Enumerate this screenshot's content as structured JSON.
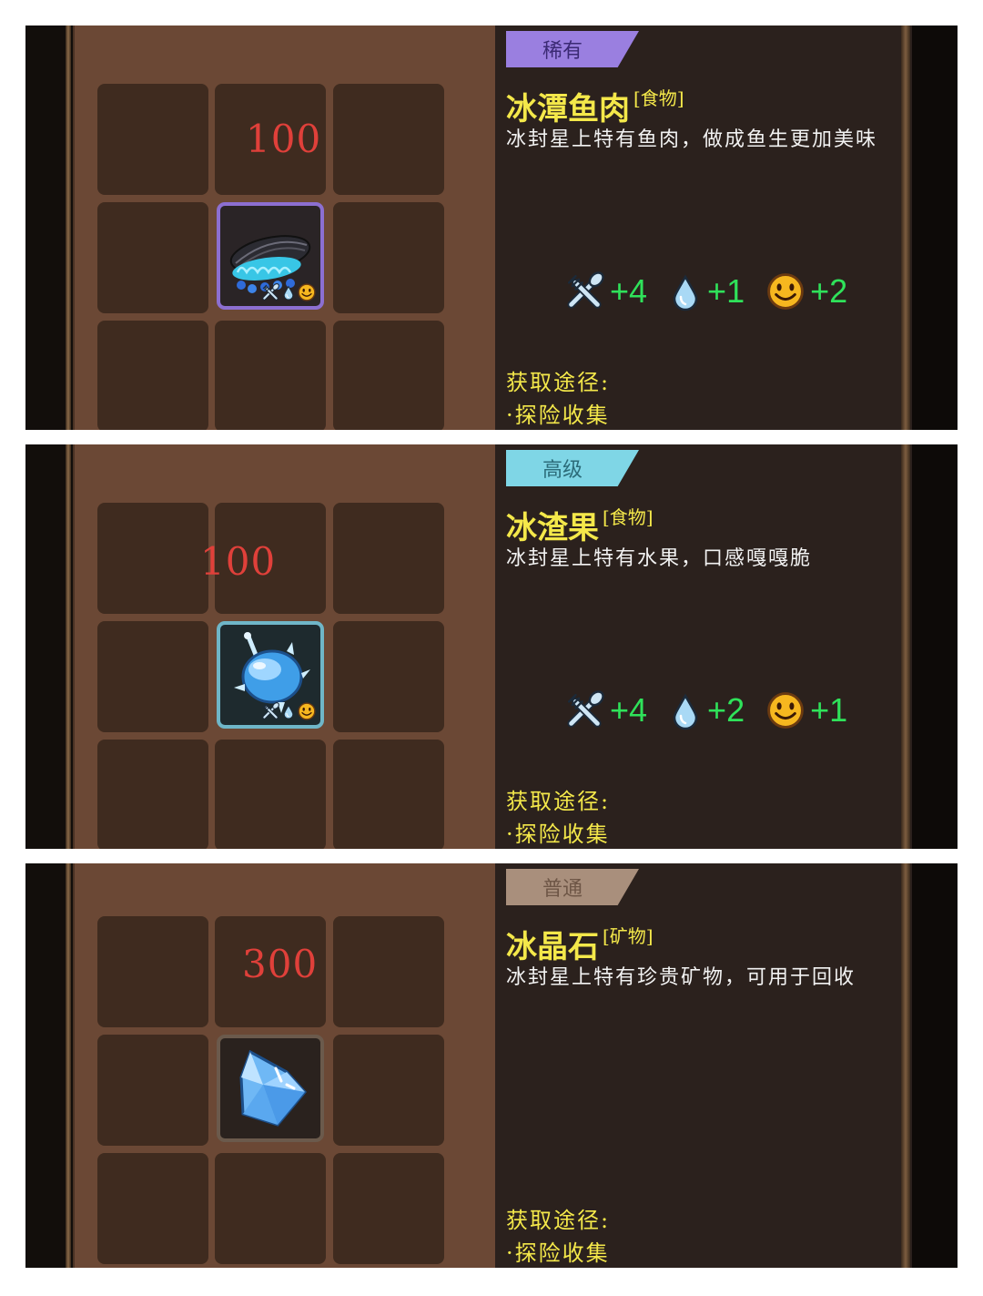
{
  "panels": [
    {
      "rarity": "稀有",
      "rarity_class": "rare",
      "count": "100",
      "name": "冰潭鱼肉",
      "type": "[食物]",
      "description": "冰封星上特有鱼肉，做成鱼生更加美味",
      "stats": {
        "hunger": "+4",
        "water": "+1",
        "mood": "+2"
      },
      "source_title": "获取途径:",
      "source_item": "·探险收集",
      "icon": "fish-meat-icon"
    },
    {
      "rarity": "高级",
      "rarity_class": "high",
      "count": "100",
      "name": "冰渣果",
      "type": "[食物]",
      "description": "冰封星上特有水果，口感嘎嘎脆",
      "stats": {
        "hunger": "+4",
        "water": "+2",
        "mood": "+1"
      },
      "source_title": "获取途径:",
      "source_item": "·探险收集",
      "icon": "ice-fruit-icon"
    },
    {
      "rarity": "普通",
      "rarity_class": "common",
      "count": "300",
      "name": "冰晶石",
      "type": "[矿物]",
      "description": "冰封星上特有珍贵矿物，可用于回收",
      "source_title": "获取途径:",
      "source_item": "·探险收集",
      "icon": "ice-crystal-icon"
    }
  ],
  "colors": {
    "rare": "#9a7fe0",
    "high": "#7fd6e6",
    "common": "#a98f7c",
    "name_yellow": "#f4e84a",
    "stat_green": "#2fe25a",
    "count_red": "#e0403a"
  }
}
